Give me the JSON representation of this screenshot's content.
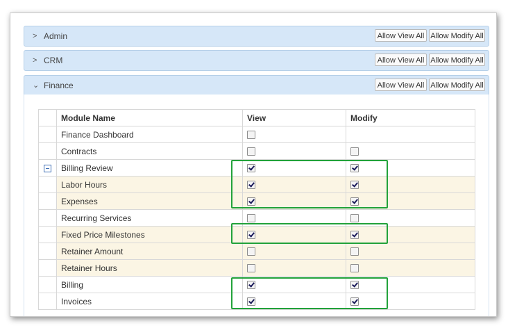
{
  "sections": [
    {
      "label": "Admin",
      "chevron": ">",
      "allow_view_label": "Allow View All",
      "allow_modify_label": "Allow Modify All"
    },
    {
      "label": "CRM",
      "chevron": ">",
      "allow_view_label": "Allow View All",
      "allow_modify_label": "Allow Modify All"
    },
    {
      "label": "Finance",
      "chevron": "⌄",
      "allow_view_label": "Allow View All",
      "allow_modify_label": "Allow Modify All"
    }
  ],
  "table": {
    "headers": [
      "Module Name",
      "View",
      "Modify"
    ],
    "rows": [
      {
        "name": "Finance Dashboard",
        "view": false,
        "modify": null
      },
      {
        "name": "Contracts",
        "view": false,
        "modify": false
      },
      {
        "name": "Billing Review",
        "view": true,
        "modify": true,
        "expand_icon": "minus"
      },
      {
        "name": "Labor Hours",
        "view": true,
        "modify": true
      },
      {
        "name": "Expenses",
        "view": true,
        "modify": true
      },
      {
        "name": "Recurring Services",
        "view": false,
        "modify": false
      },
      {
        "name": "Fixed Price Milestones",
        "view": true,
        "modify": true
      },
      {
        "name": "Retainer Amount",
        "view": false,
        "modify": false
      },
      {
        "name": "Retainer Hours",
        "view": false,
        "modify": false
      },
      {
        "name": "Billing",
        "view": true,
        "modify": true
      },
      {
        "name": "Invoices",
        "view": true,
        "modify": true
      }
    ]
  },
  "colors": {
    "section_bar": "#d6e7f8",
    "highlight_row": "#fbf5e4",
    "annotation_box": "#22a23a",
    "expand_icon": "#3f6fb5"
  }
}
